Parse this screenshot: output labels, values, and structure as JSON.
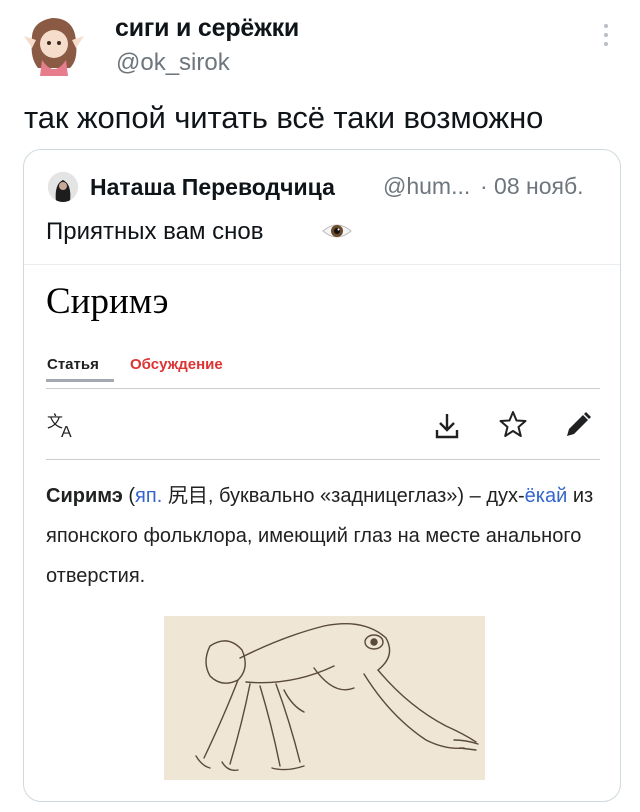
{
  "tweet": {
    "author_name": "сиги и серёжки",
    "author_handle": "@ok_sirok",
    "text": "так жопой читать всё таки возможно"
  },
  "quoted_tweet": {
    "author_name": "Наташа Переводчица",
    "author_handle": "@hum...",
    "date": "· 08 нояб.",
    "text": "Приятных вам снов",
    "emoji_icon": "eye-icon"
  },
  "wiki": {
    "title": "Сиримэ",
    "tabs": [
      "Статья",
      "Обсуждение"
    ],
    "article": {
      "term": "Сиримэ",
      "open_paren": " (",
      "lang": "яп.",
      "kanji": " 尻目",
      "after_kanji": ", буквально «задницеглаз») – дух-",
      "link_yokai": "ёкай",
      "rest": " из японского фольклора, имеющий глаз на месте анального отверстия."
    }
  },
  "colors": {
    "secondary_text": "#6e767d",
    "wiki_link": "#3366cc",
    "wiki_talk_red": "#d33"
  }
}
